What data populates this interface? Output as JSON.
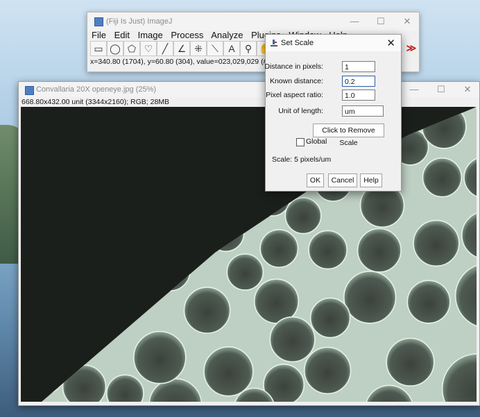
{
  "fiji_window": {
    "title": "(Fiji Is Just) ImageJ",
    "menu": [
      "File",
      "Edit",
      "Image",
      "Process",
      "Analyze",
      "Plugins",
      "Window",
      "Help"
    ],
    "tools": [
      {
        "name": "rectangle-tool-icon",
        "glyph": "▭"
      },
      {
        "name": "oval-tool-icon",
        "glyph": "◯"
      },
      {
        "name": "polygon-tool-icon",
        "glyph": "⬠"
      },
      {
        "name": "freehand-tool-icon",
        "glyph": "♡"
      },
      {
        "name": "line-tool-icon",
        "glyph": "╱"
      },
      {
        "name": "angle-tool-icon",
        "glyph": "∠"
      },
      {
        "name": "point-tool-icon",
        "glyph": "⁜"
      },
      {
        "name": "wand-tool-icon",
        "glyph": "⟍"
      },
      {
        "name": "text-tool-icon",
        "glyph": "A"
      },
      {
        "name": "magnifier-tool-icon",
        "glyph": "⚲"
      },
      {
        "name": "hand-tool-icon",
        "glyph": "✋"
      }
    ],
    "more_tools_glyph": "≫",
    "status": "x=340.80 (1704), y=60.80 (304), value=023,029,029 (#1"
  },
  "image_window": {
    "title": "Convallaria 20X openeye.jpg (25%)",
    "info": "668.80x432.00 unit (3344x2160); RGB; 28MB"
  },
  "dialog": {
    "title": "Set Scale",
    "close": "✕",
    "fields": {
      "distance_pixels": {
        "label": "Distance in pixels:",
        "value": "1"
      },
      "known_distance": {
        "label": "Known distance:",
        "value": "0.2"
      },
      "aspect_ratio": {
        "label": "Pixel aspect ratio:",
        "value": "1.0"
      },
      "unit": {
        "label": "Unit of length:",
        "value": "um"
      }
    },
    "remove_scale": "Click to Remove Scale",
    "global_label": "Global",
    "scale_text": "Scale: 5 pixels/um",
    "ok": "OK",
    "cancel": "Cancel",
    "help": "Help"
  },
  "window_controls": {
    "minimize": "—",
    "maximize": "☐",
    "close": "✕"
  },
  "colors": {
    "more_tools": "#c0201a",
    "canvas_bg": "#1b1f1b",
    "cell_wall": "#cfe3d4"
  }
}
